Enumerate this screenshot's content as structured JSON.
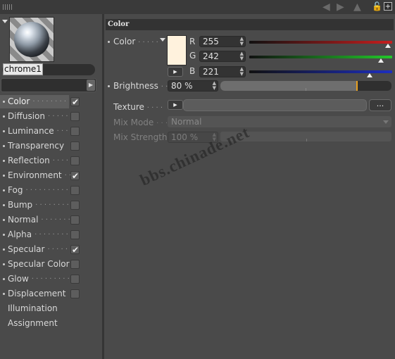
{
  "material": {
    "name": "chrome1"
  },
  "channels": [
    {
      "label": "Color",
      "dots": "· · · · · · · ·",
      "checked": true,
      "selected": true,
      "has_checkbox": true
    },
    {
      "label": "Diffusion",
      "dots": "· · · · ·",
      "checked": false,
      "selected": false,
      "has_checkbox": true
    },
    {
      "label": "Luminance",
      "dots": "· · ·",
      "checked": false,
      "selected": false,
      "has_checkbox": true
    },
    {
      "label": "Transparency",
      "dots": "",
      "checked": false,
      "selected": false,
      "has_checkbox": true
    },
    {
      "label": "Reflection",
      "dots": "· · · ·",
      "checked": false,
      "selected": false,
      "has_checkbox": true
    },
    {
      "label": "Environment",
      "dots": "· ·",
      "checked": true,
      "selected": false,
      "has_checkbox": true
    },
    {
      "label": "Fog",
      "dots": "· · · · · · · · · ·",
      "checked": false,
      "selected": false,
      "has_checkbox": true
    },
    {
      "label": "Bump",
      "dots": "· · · · · · · ·",
      "checked": false,
      "selected": false,
      "has_checkbox": true
    },
    {
      "label": "Normal",
      "dots": "· · · · · · ·",
      "checked": false,
      "selected": false,
      "has_checkbox": true
    },
    {
      "label": "Alpha",
      "dots": "· · · · · · · ·",
      "checked": false,
      "selected": false,
      "has_checkbox": true
    },
    {
      "label": "Specular",
      "dots": "· · · · ·",
      "checked": true,
      "selected": false,
      "has_checkbox": true
    },
    {
      "label": "Specular Color",
      "dots": "",
      "checked": false,
      "selected": false,
      "has_checkbox": true
    },
    {
      "label": "Glow",
      "dots": "· · · · · · · · ·",
      "checked": false,
      "selected": false,
      "has_checkbox": true
    },
    {
      "label": "Displacement",
      "dots": "",
      "checked": false,
      "selected": false,
      "has_checkbox": true
    },
    {
      "label": "Illumination",
      "dots": "",
      "checked": false,
      "selected": false,
      "has_checkbox": false
    },
    {
      "label": "Assignment",
      "dots": "",
      "checked": false,
      "selected": false,
      "has_checkbox": false
    }
  ],
  "color_panel": {
    "section_title": "Color",
    "color_label": "Color",
    "color_dots": "· · · · ·",
    "swatch_color": "#fff2dd",
    "r_label": "R",
    "g_label": "G",
    "b_label": "B",
    "r_value": "255",
    "g_value": "242",
    "b_value": "221",
    "brightness_label": "Brightness",
    "brightness_dots": "· ·",
    "brightness_value": "80 %",
    "brightness_fraction": 0.8,
    "texture_label": "Texture",
    "texture_dots": "· · · ·",
    "texture_more": "...",
    "mix_mode_label": "Mix Mode",
    "mix_mode_dots": "· · ·",
    "mix_mode_value": "Normal",
    "mix_strength_label": "Mix Strength",
    "mix_strength_value": "100 %"
  },
  "watermark": "bbs.chinade.net",
  "colors": {
    "red_channel": "#c81e1e",
    "green_channel": "#22c82a",
    "blue_channel": "#1d2ec0",
    "accent_marker": "#e8a020"
  }
}
